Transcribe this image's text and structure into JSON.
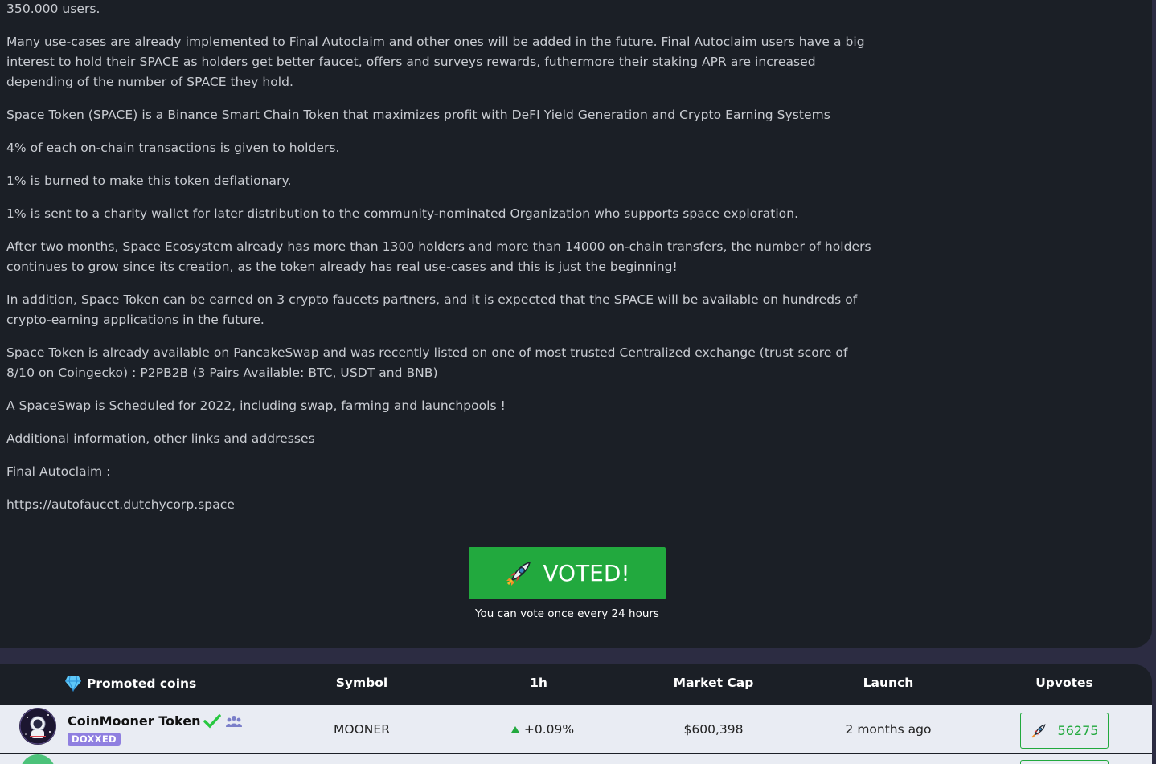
{
  "description": {
    "paragraphs": [
      "350.000 users.",
      "Many use-cases are already implemented to Final Autoclaim and other ones will be added in the future. Final Autoclaim users have a big interest to hold their SPACE as holders get better faucet, offers and surveys rewards, futhermore their staking APR are increased depending of the number of SPACE they hold.",
      "Space Token (SPACE) is a Binance Smart Chain Token that maximizes profit with DeFI Yield Generation and Crypto Earning Systems",
      "4% of each on-chain transactions is given to holders.",
      "1% is burned to make this token deflationary.",
      "1% is sent to a charity wallet for later distribution to the community-nominated Organization who supports space exploration.",
      "After two months, Space Ecosystem already has more than 1300 holders and more than 14000 on-chain transfers, the number of holders continues to grow since its creation, as the token already has real use-cases and this is just the beginning!",
      "In addition, Space Token can be earned on 3 crypto faucets partners, and it is expected that the SPACE will be available on hundreds of crypto-earning applications in the future.",
      "Space Token is already available on PancakeSwap and was recently listed on one of most trusted Centralized exchange (trust score of 8/10 on Coingecko) : P2PB2B (3 Pairs Available: BTC, USDT and BNB)",
      "A SpaceSwap is Scheduled for 2022, including swap, farming and launchpools !",
      "Additional information, other links and addresses",
      "Final Autoclaim :",
      "https://autofaucet.dutchycorp.space"
    ]
  },
  "vote": {
    "button_label": "VOTED!",
    "note": "You can vote once every 24 hours"
  },
  "promoted": {
    "headers": {
      "name": "Promoted coins",
      "symbol": "Symbol",
      "change": "1h",
      "market_cap": "Market Cap",
      "launch": "Launch",
      "upvotes": "Upvotes"
    },
    "rows": [
      {
        "name": "CoinMooner Token",
        "badge": "DOXXED",
        "symbol": "MOONER",
        "change": "+0.09%",
        "market_cap": "$600,398",
        "launch": "2 months ago",
        "upvotes": "56275"
      }
    ]
  },
  "colors": {
    "page_bg": "#2c2c42",
    "card_bg": "#1b1f26",
    "accent_green": "#22a93e",
    "badge_purple": "#8f7fe0",
    "row_bg": "#e9ecf3"
  },
  "icons": [
    "rocket-icon",
    "diamond-icon",
    "verified-check-icon",
    "team-icon",
    "triangle-up-icon"
  ]
}
